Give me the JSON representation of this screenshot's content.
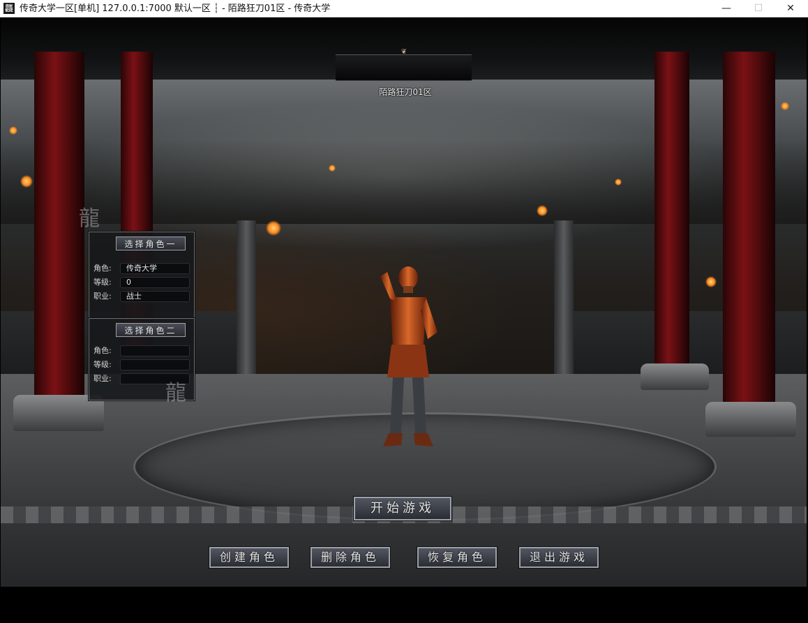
{
  "window": {
    "app_icon_glyph": "龘",
    "title": "传奇大学一区[单机] 127.0.0.1:7000  默认一区 ┆ - 陌路狂刀01区 - 传奇大学",
    "minimize_glyph": "—",
    "maximize_glyph": "☐",
    "close_glyph": "✕"
  },
  "server": {
    "name": "陌路狂刀01区",
    "ornament_glyph": "❦"
  },
  "role_slot_1": {
    "button_label": "选择角色一",
    "name_label": "角色:",
    "name_value": "传奇大学",
    "level_label": "等级:",
    "level_value": "0",
    "class_label": "职业:",
    "class_value": "战士"
  },
  "role_slot_2": {
    "button_label": "选择角色二",
    "name_label": "角色:",
    "name_value": "",
    "level_label": "等级:",
    "level_value": "",
    "class_label": "职业:",
    "class_value": ""
  },
  "actions": {
    "start": "开始游戏",
    "create": "创建角色",
    "delete": "删除角色",
    "restore": "恢复角色",
    "exit": "退出游戏"
  },
  "colors": {
    "pillar_red": "#7a1115",
    "button_border": "#9ba0aa",
    "ember": "#ff8a1e",
    "armor": "#c2551e"
  },
  "icons": {
    "app": "game-app-icon",
    "dragon_ornament": "dragon-ornament-icon"
  }
}
